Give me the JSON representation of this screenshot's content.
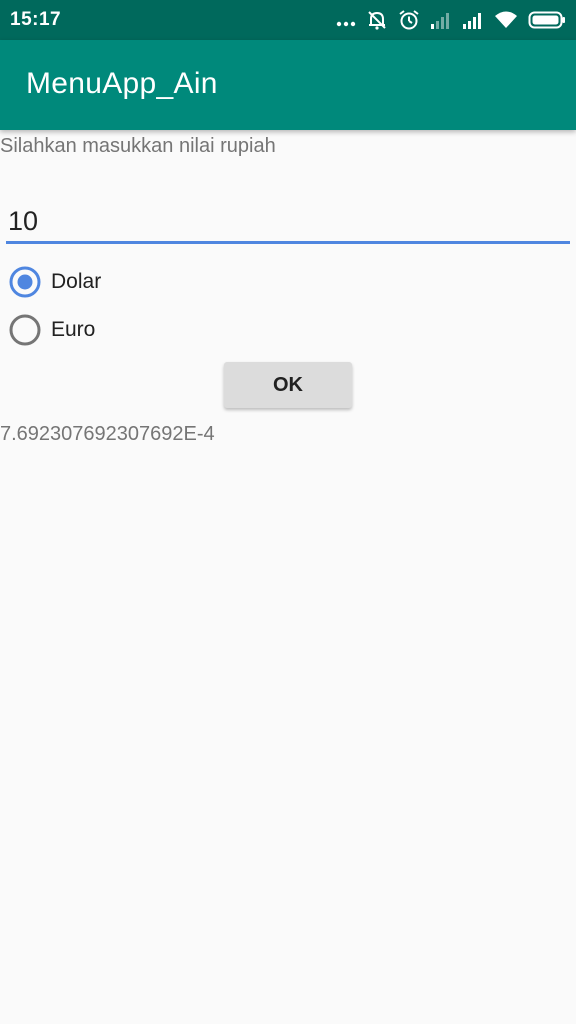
{
  "status_bar": {
    "time": "15:17",
    "icons": [
      "more-dots-icon",
      "alarm-off-icon",
      "alarm-icon",
      "signal-weak-icon",
      "signal-icon",
      "wifi-icon",
      "battery-icon"
    ]
  },
  "app_bar": {
    "title": "MenuApp_Ain"
  },
  "form": {
    "prompt": "Silahkan masukkan nilai rupiah",
    "amount_value": "10",
    "currency_options": [
      {
        "label": "Dolar",
        "selected": true
      },
      {
        "label": "Euro",
        "selected": false
      }
    ],
    "ok_label": "OK",
    "result": "7.692307692307692E-4"
  },
  "colors": {
    "status_bar": "#00695c",
    "app_bar": "#00897b",
    "accent": "#4f86e0",
    "background": "#fafafa"
  }
}
